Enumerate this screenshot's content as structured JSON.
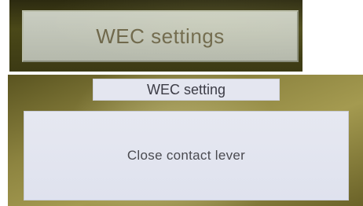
{
  "top_screen": {
    "menu_button_label": "WEC settings"
  },
  "bottom_screen": {
    "title": "WEC setting",
    "message": "Close contact lever"
  },
  "colors": {
    "button_background": "#c2c6b9",
    "button_text": "#6b6448",
    "panel_background": "#e2e5ef",
    "panel_text": "#4a4a50",
    "bezel": "#4a4818"
  }
}
